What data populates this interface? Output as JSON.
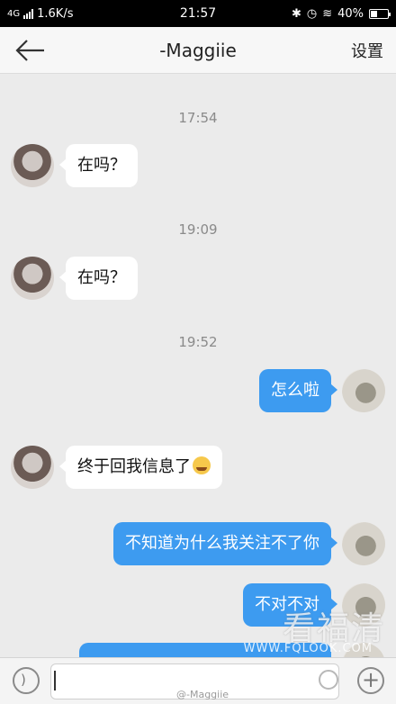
{
  "status_bar": {
    "network": "4G",
    "speed": "1.6K/s",
    "time": "21:57",
    "battery": "40%",
    "battery_level": 0.4
  },
  "header": {
    "title": "-Maggiie",
    "settings_label": "设置"
  },
  "chat": {
    "messages": [
      {
        "type": "timestamp",
        "text": "17:54"
      },
      {
        "type": "incoming",
        "text": "在吗？"
      },
      {
        "type": "timestamp",
        "text": "19:09"
      },
      {
        "type": "incoming",
        "text": "在吗？"
      },
      {
        "type": "timestamp",
        "text": "19:52"
      },
      {
        "type": "outgoing",
        "text": "怎么啦"
      },
      {
        "type": "incoming",
        "text": "终于回我信息了",
        "emoji": "crying-face-icon"
      },
      {
        "type": "outgoing",
        "text": "不知道为什么我关注不了你"
      },
      {
        "type": "outgoing",
        "text": "不对不对"
      },
      {
        "type": "outgoing",
        "text": ""
      }
    ]
  },
  "input_bar": {
    "value": "",
    "watermark_handle": "@-Maggiie"
  },
  "watermark": {
    "text": "看福清",
    "url": "WWW.FQLOOK.COM"
  },
  "colors": {
    "outgoing_bubble": "#3d9bf0",
    "incoming_bubble": "#ffffff",
    "background": "#ebebeb"
  }
}
